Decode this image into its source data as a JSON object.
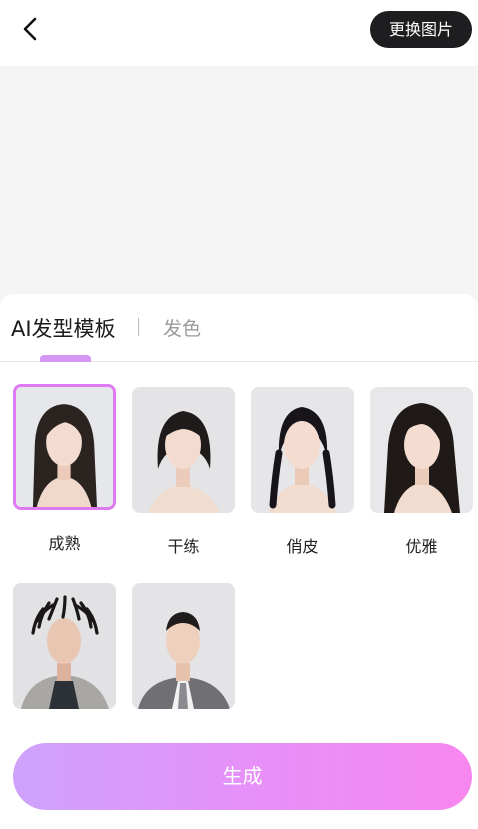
{
  "header": {
    "back_icon": "chevron-left-icon",
    "change_image_label": "更换图片"
  },
  "tabs": [
    {
      "label": "AI发型模板",
      "active": true
    },
    {
      "label": "发色",
      "active": false
    }
  ],
  "templates": [
    {
      "label": "成熟",
      "selected": true
    },
    {
      "label": "干练",
      "selected": false
    },
    {
      "label": "俏皮",
      "selected": false
    },
    {
      "label": "优雅",
      "selected": false
    },
    {
      "label": "",
      "selected": false
    },
    {
      "label": "",
      "selected": false
    }
  ],
  "generate_label": "生成",
  "colors": {
    "accent_start": "#cda3fb",
    "accent_end": "#f787ef",
    "selected_border": "#e07af2",
    "dark_button": "#1e1e20"
  }
}
